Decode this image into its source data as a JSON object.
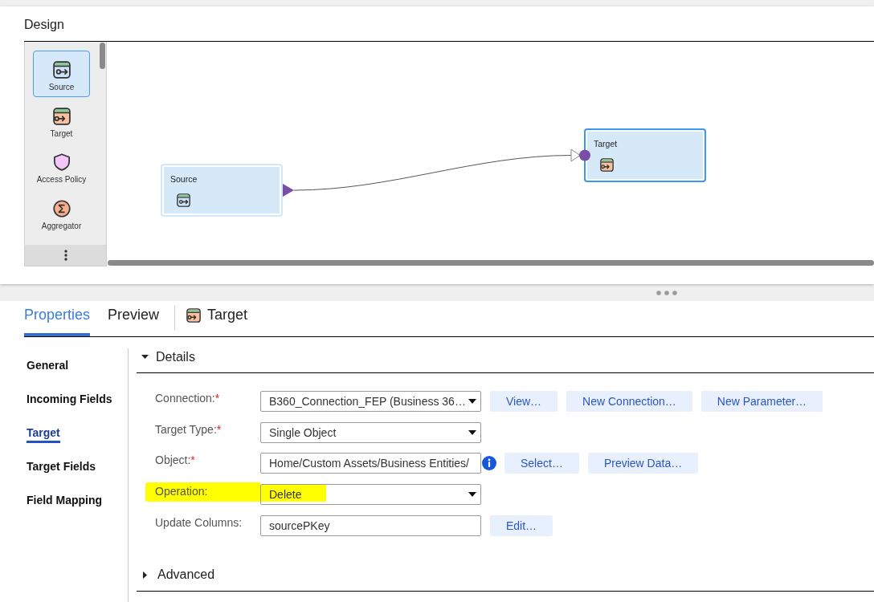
{
  "design": {
    "title": "Design",
    "palette": [
      {
        "label": "Source",
        "kind": "source",
        "selected": true
      },
      {
        "label": "Target",
        "kind": "target",
        "selected": false
      },
      {
        "label": "Access Policy",
        "kind": "access_policy",
        "selected": false
      },
      {
        "label": "Aggregator",
        "kind": "aggregator",
        "selected": false
      }
    ],
    "nodes": [
      {
        "label": "Source",
        "kind": "source",
        "selected": false,
        "in_port": false,
        "out_port": true
      },
      {
        "label": "Target",
        "kind": "target",
        "selected": true,
        "in_port": true,
        "out_port": false
      }
    ]
  },
  "properties": {
    "tabs": [
      {
        "label": "Properties",
        "selected": true
      },
      {
        "label": "Preview",
        "selected": false
      }
    ],
    "context": {
      "label": "Target",
      "kind": "target"
    },
    "nav": [
      {
        "label": "General",
        "selected": false
      },
      {
        "label": "Incoming Fields",
        "selected": false
      },
      {
        "label": "Target",
        "selected": true
      },
      {
        "label": "Target Fields",
        "selected": false
      },
      {
        "label": "Field Mapping",
        "selected": false
      }
    ],
    "sections": [
      {
        "title": "Details",
        "expanded": true,
        "rows": [
          {
            "label": "Connection:",
            "required_mark": "*",
            "kind": "select",
            "value": "B360_Connection_FEP (Business 36…",
            "info": false,
            "highlighted": false,
            "buttons": [
              "View…",
              "New Connection…",
              "New Parameter…"
            ]
          },
          {
            "label": "Target Type:",
            "required_mark": "*",
            "kind": "select",
            "value": "Single Object",
            "info": false,
            "highlighted": false
          },
          {
            "label": "Object:",
            "required_mark": "*",
            "kind": "text",
            "value": "Home/Custom Assets/Business Entities/",
            "info": true,
            "highlighted": false,
            "buttons": [
              "Select…",
              "Preview Data…"
            ]
          },
          {
            "label": "Operation:",
            "kind": "select",
            "value": "Delete",
            "info": false,
            "highlighted": true
          },
          {
            "label": "Update Columns:",
            "kind": "text",
            "value": "sourcePKey",
            "info": false,
            "highlighted": false,
            "buttons": [
              "Edit…"
            ]
          }
        ]
      },
      {
        "title": "Advanced",
        "expanded": false
      }
    ]
  }
}
